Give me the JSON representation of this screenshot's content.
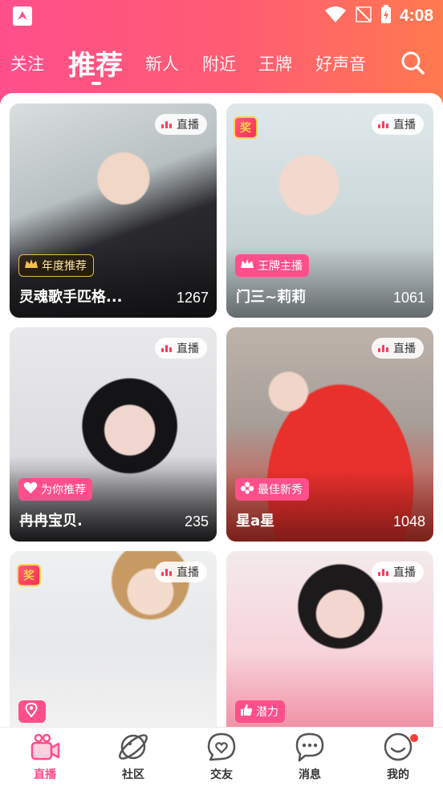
{
  "status_bar": {
    "time": "4:08"
  },
  "tabs": [
    {
      "label": "关注",
      "active": false
    },
    {
      "label": "推荐",
      "active": true
    },
    {
      "label": "新人",
      "active": false
    },
    {
      "label": "附近",
      "active": false
    },
    {
      "label": "王牌",
      "active": false
    },
    {
      "label": "好声音",
      "active": false
    }
  ],
  "colors": {
    "brand_pink": "#ff4f8b",
    "brand_orange": "#ff7a4e",
    "live_red": "#ff3b5c"
  },
  "cards": [
    {
      "live_label": "直播",
      "tag": "年度推荐",
      "tag_icon": "crown-icon",
      "name": "灵魂歌手匹格...",
      "count": "1267"
    },
    {
      "live_label": "直播",
      "tag": "王牌主播",
      "tag_icon": "crown-icon",
      "name": "门三~莉莉",
      "count": "1061",
      "reward": "奖"
    },
    {
      "live_label": "直播",
      "tag": "为你推荐",
      "tag_icon": "heart-icon",
      "name": "冉冉宝贝.",
      "count": "235"
    },
    {
      "live_label": "直播",
      "tag": "最佳新秀",
      "tag_icon": "flower-icon",
      "name": "星a星",
      "count": "1048"
    },
    {
      "live_label": "直播",
      "tag": "",
      "tag_icon": "location-icon",
      "name": "",
      "count": "",
      "reward": "奖"
    },
    {
      "live_label": "直播",
      "tag": "潜力",
      "tag_icon": "thumbs-up-icon",
      "name": "",
      "count": ""
    }
  ],
  "bottom_nav": [
    {
      "label": "直播",
      "icon": "video-camera-icon",
      "active": true
    },
    {
      "label": "社区",
      "icon": "planet-icon",
      "active": false
    },
    {
      "label": "交友",
      "icon": "heart-bubble-icon",
      "active": false
    },
    {
      "label": "消息",
      "icon": "chat-bubble-icon",
      "active": false
    },
    {
      "label": "我的",
      "icon": "profile-icon",
      "active": false,
      "badge_dot": true
    }
  ]
}
